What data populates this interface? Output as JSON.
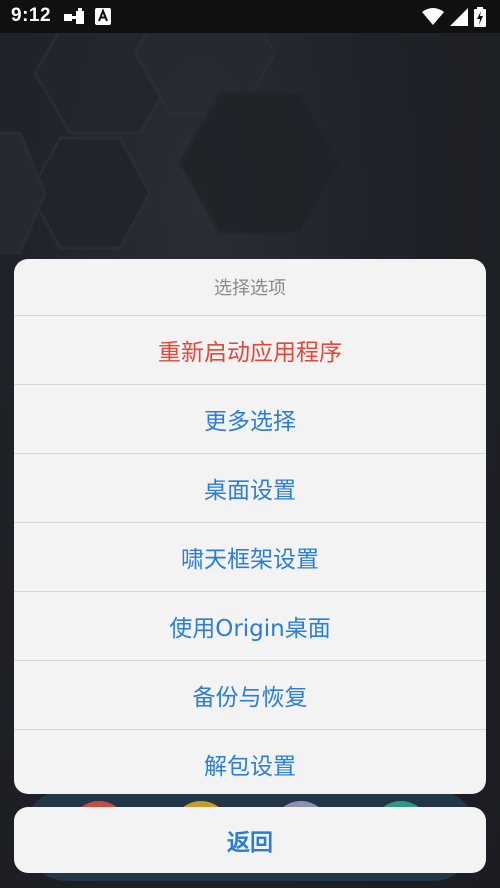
{
  "status_bar": {
    "time": "9:12",
    "notification_icons": [
      "usb-debug-icon",
      "a-badge-icon"
    ],
    "system_icons": [
      "wifi-icon",
      "cellular-signal-icon",
      "battery-charging-icon"
    ]
  },
  "action_sheet": {
    "title": "选择选项",
    "items": [
      {
        "label": "重新启动应用程序",
        "color": "#e04a3a"
      },
      {
        "label": "更多选择",
        "color": "#2c7fd0"
      },
      {
        "label": "桌面设置",
        "color": "#2c7fd0"
      },
      {
        "label": "啸天框架设置",
        "color": "#2c7fd0"
      },
      {
        "label": "使用Origin桌面",
        "color": "#2c7fd0"
      },
      {
        "label": "备份与恢复",
        "color": "#2c7fd0"
      },
      {
        "label": "解包设置",
        "color": "#2c7fd0"
      }
    ],
    "cancel_label": "返回"
  },
  "dock": {
    "app_colors": [
      "#c2503f",
      "#c99a2a",
      "#8f8fb5",
      "#2f9a82"
    ]
  },
  "colors": {
    "accent_blue": "#2c7fd0",
    "destructive_red": "#e04a3a",
    "sheet_bg": "#f3f3f3"
  }
}
